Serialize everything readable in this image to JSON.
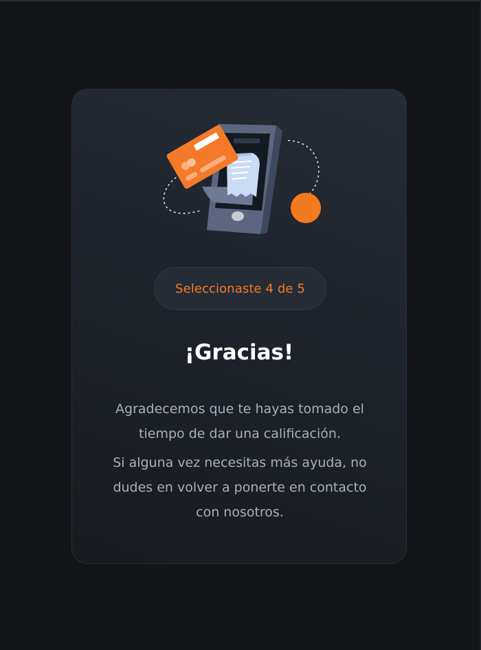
{
  "feedback": {
    "rating_selected": 4,
    "rating_max": 5,
    "badge_text": "Seleccionaste 4 de 5",
    "title": "¡Gracias!",
    "message_line1": "Agradecemos que te hayas tomado el tiempo de dar una calificación.",
    "message_line2": "Si alguna vez necesitas más ayuda, no dudes en volver a ponerte en contacto con nosotros."
  },
  "illustration": {
    "icon": "payment-phone-illustration"
  },
  "colors": {
    "background": "#131518",
    "card": "#20252d",
    "accent": "#f47a2a",
    "title": "#ffffff",
    "body_text": "#a8b0bc",
    "phone": "#5b6780"
  }
}
